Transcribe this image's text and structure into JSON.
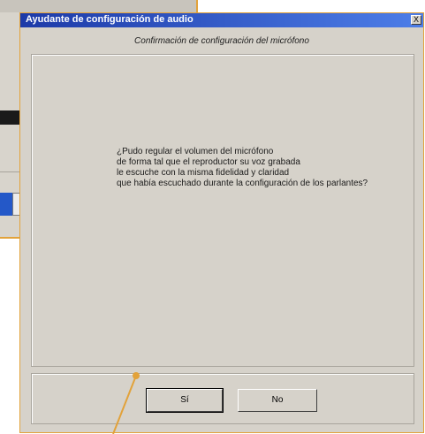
{
  "dialog": {
    "title": "Ayudante de configuración de audio",
    "close_glyph": "X",
    "subtitle": "Confirmación de configuración del micrófono",
    "message_lines": [
      "¿Pudo regular el volumen del micrófono",
      "de forma tal que el reproductor su voz grabada",
      "le escuche con la misma fidelidad y claridad",
      "que había escuchado durante la configuración de los parlantes?"
    ],
    "buttons": {
      "yes_label": "Sí",
      "no_label": "No"
    }
  },
  "colors": {
    "dialog_bg": "#d6d2ca",
    "titlebar_start": "#1d3aa8",
    "titlebar_end": "#4d7ee8",
    "border_accent": "#e2a23a"
  }
}
